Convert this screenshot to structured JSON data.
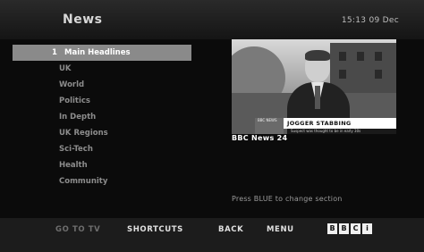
{
  "header": {
    "title": "News",
    "time": "15:13 09 Dec"
  },
  "menu": {
    "items": [
      {
        "label": "Main Headlines",
        "number": "1",
        "selected": true
      },
      {
        "label": "UK"
      },
      {
        "label": "World"
      },
      {
        "label": "Politics"
      },
      {
        "label": "In Depth"
      },
      {
        "label": "UK Regions"
      },
      {
        "label": "Sci-Tech"
      },
      {
        "label": "Health"
      },
      {
        "label": "Community"
      }
    ]
  },
  "video": {
    "caption_title": "JOGGER STABBING",
    "caption_subtitle": "Suspect was thought to be in early 30s",
    "caption_logo_text": "BBC NEWS"
  },
  "channel_label": "BBC News 24",
  "hint": "Press BLUE to change section",
  "footer": {
    "buttons": [
      {
        "label": "GO TO TV",
        "dim": true
      },
      {
        "label": "SHORTCUTS"
      },
      {
        "label": "BACK"
      },
      {
        "label": "MENU"
      }
    ],
    "logo_letters": [
      "B",
      "B",
      "C",
      "i"
    ]
  },
  "colors": {
    "background": "#0b0b0b",
    "selected_row": "#8a8a8a",
    "menu_text": "#8c8c8c",
    "footer_bg": "#1c1c1c"
  }
}
